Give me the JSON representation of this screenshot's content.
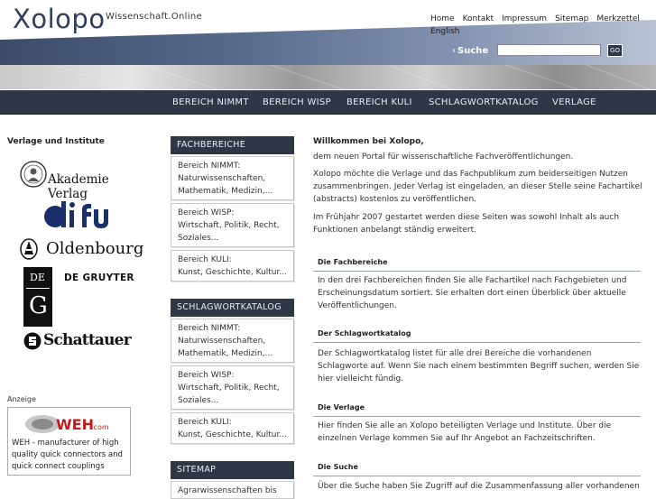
{
  "header": {
    "logo": "Xolopo",
    "tagline": "Wissenschaft.Online",
    "topnav": [
      "Home",
      "Kontakt",
      "Impressum",
      "Sitemap",
      "Merkzettel",
      "English"
    ],
    "search_label": "Suche",
    "search_arrow": "›",
    "search_value": "",
    "go_label": "GO"
  },
  "mainnav": [
    "BEREICH NIMMT",
    "BEREICH WISP",
    "BEREICH KULI",
    "SCHLAGWORTKATALOG",
    "VERLAGE"
  ],
  "left": {
    "title": "Verlage und Institute",
    "publishers": {
      "akademie": "Akademie Verlag",
      "difu": "difu",
      "oldenbourg": "Oldenbourg",
      "degruyter_box": [
        "DE",
        "G"
      ],
      "degruyter": "DE GRUYTER",
      "schattauer": "Schattauer"
    },
    "anzeige": "Anzeige",
    "ad_logo": "WEH",
    "ad_logo_suffix": ".com",
    "ad_text": "WEH - manufacturer of high quality quick connectors and quick connect couplings"
  },
  "middle": {
    "fachbereiche_title": "FACHBEREICHE",
    "fachbereiche": [
      {
        "title": "Bereich NIMMT:",
        "desc": "Naturwissenschaften, Mathematik, Medizin,..."
      },
      {
        "title": "Bereich WISP:",
        "desc": "Wirtschaft, Politik, Recht, Soziales..."
      },
      {
        "title": "Bereich KULI:",
        "desc": "Kunst, Geschichte, Kultur..."
      }
    ],
    "schlagwort_title": "SCHLAGWORTKATALOG",
    "schlagwort": [
      {
        "title": "Bereich NIMMT:",
        "desc": "Naturwissenschaften, Mathematik, Medizin,..."
      },
      {
        "title": "Bereich WISP:",
        "desc": "Wirtschaft, Politik, Recht, Soziales..."
      },
      {
        "title": "Bereich KULI:",
        "desc": "Kunst, Geschichte, Kultur..."
      }
    ],
    "sitemap_title": "SITEMAP",
    "sitemap_first": "Agrarwissenschaften bis"
  },
  "content": {
    "welcome_title": "Willkommen bei Xolopo,",
    "welcome_sub": "dem neuen Portal für wissenschaftliche Fachveröffentlichungen.",
    "intro": "Xolopo möchte die Verlage und das Fachpublikum zum beiderseitigen Nutzen zusammenbringen. Jeder Verlag ist eingeladen, an dieser Stelle seine Fachartikel (abstracts) kostenlos zu veröffentlichen.",
    "spring": "Im Frühjahr 2007 gestartet werden diese Seiten was sowohl Inhalt als auch Funktionen anbelangt ständig erweitert.",
    "sections": [
      {
        "title": "Die Fachbereiche",
        "text": "In den drei Fachbereichen finden Sie alle Fachartikel nach Fachgebieten und Erscheinungsdatum sortiert. Sie erhalten dort einen Überblick über aktuelle Veröffentlichungen."
      },
      {
        "title": "Der Schlagwortkatalog",
        "text": "Der Schlagwortkatalog listet für alle drei Bereiche die vorhandenen Schlagworte auf. Wenn Sie nach einem bestimmten Begriff suchen, werden Sie hier vielleicht fündig."
      },
      {
        "title": "Die Verlage",
        "text": "Hier finden Sie alle an Xolopo beteiligten Verlage und Institute. Über die einzelnen Verlage kommen Sie auf Ihr Angebot an Fachzeitschriften."
      },
      {
        "title": "Die Suche",
        "text": "Über die Suche haben Sie Zugriff auf die Zusammenfassung aller vorhandenen"
      }
    ]
  }
}
